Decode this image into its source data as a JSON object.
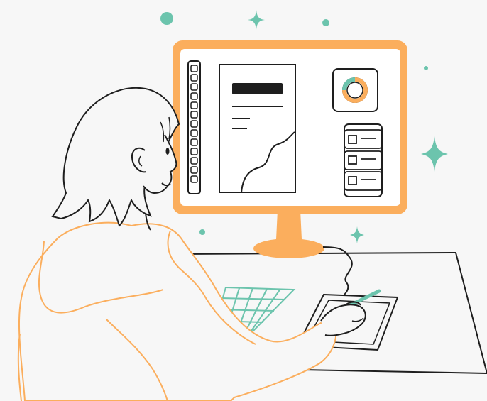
{
  "illustration": {
    "subject": "person-drawing-with-tablet-at-monitor",
    "colors": {
      "background": "#f7f7f7",
      "accent_orange": "#fbae5d",
      "accent_teal": "#6cc4ad",
      "ink": "#1e1e1e",
      "screen": "#ffffff"
    },
    "icons": [
      "sparkle-icon",
      "dot-icon",
      "donut-chart-icon",
      "checkbox-icon"
    ]
  }
}
